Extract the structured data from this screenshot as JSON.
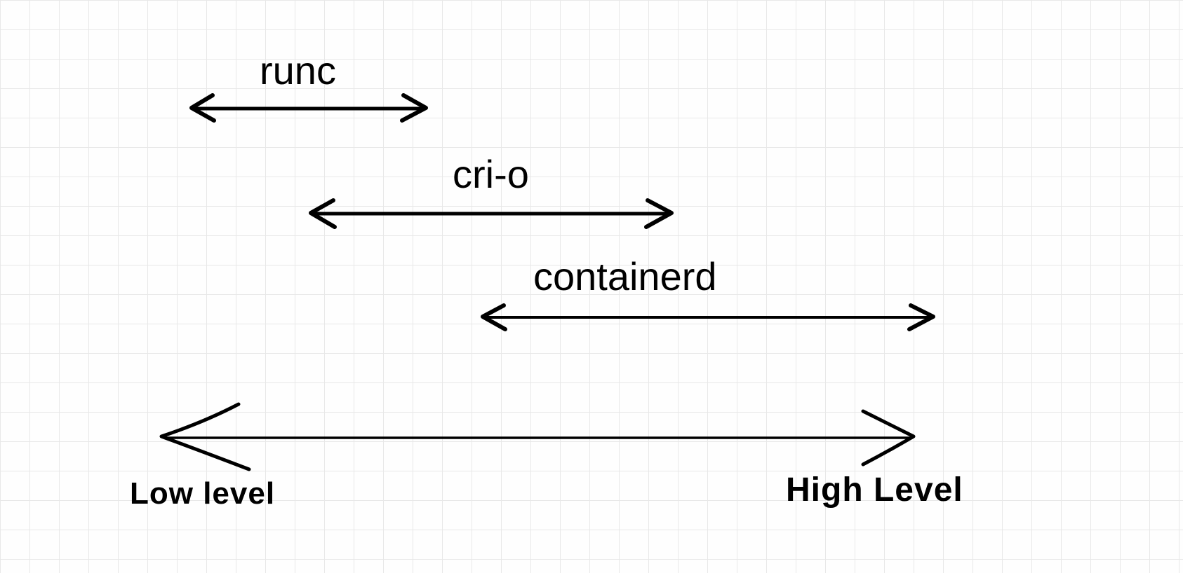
{
  "items": {
    "runc": {
      "label": "runc"
    },
    "crio": {
      "label": "cri-o"
    },
    "containerd": {
      "label": "containerd"
    }
  },
  "axis": {
    "low_label": "Low level",
    "high_label": "High Level"
  }
}
